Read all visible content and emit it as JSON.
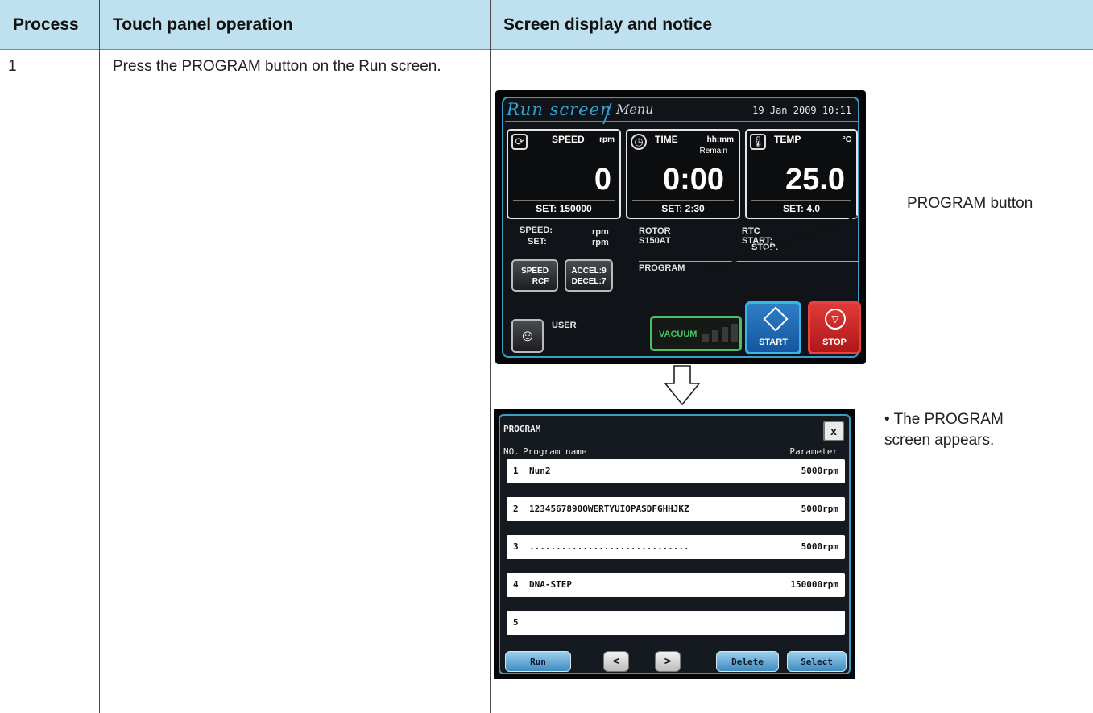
{
  "table": {
    "headers": [
      "Process",
      "Touch panel operation",
      "Screen display and notice"
    ],
    "row1": {
      "process": "1",
      "operation": "Press the PROGRAM button on the Run screen."
    }
  },
  "run_screen": {
    "tab_run": "Run screen",
    "tab_menu": "Menu",
    "datetime": "19 Jan 2009 10:11",
    "speed": {
      "label": "SPEED",
      "unit": "rpm",
      "value": "0",
      "set_label": "SET:",
      "set_value": "150000"
    },
    "time": {
      "label": "TIME",
      "unit": "hh:mm",
      "sub": "Remain",
      "value": "0:00",
      "set_label": "SET:",
      "set_value": "2:30"
    },
    "temp": {
      "label": "TEMP",
      "unit": "°C",
      "value": "25.0",
      "set_label": "SET:",
      "set_value": "4.0"
    },
    "speed_line": "SPEED:",
    "set_line": "SET:",
    "rpm1": "rpm",
    "rpm2": "rpm",
    "speed_rcf_top": "SPEED",
    "speed_rcf_bottom": "RCF",
    "accel": "ACCEL:9",
    "decel": "DECEL:7",
    "rotor_label": "ROTOR",
    "rotor_value": "S150AT",
    "rtc_label": "RTC",
    "rtc_start": "START:",
    "rtc_stop": "STOP:",
    "program_label": "PROGRAM",
    "user_label": "USER",
    "vacuum_label": "VACUUM",
    "start_label": "START",
    "stop_label": "STOP"
  },
  "callout_program_button": "PROGRAM button",
  "program_screen": {
    "title": "PROGRAM",
    "col_no": "NO.",
    "col_name": "Program name",
    "col_param": "Parameter",
    "rows": [
      {
        "no": "1",
        "name": "Nun2",
        "param": "5000rpm"
      },
      {
        "no": "2",
        "name": "1234567890QWERTYUIOPASDFGHHJKZ",
        "param": "5000rpm"
      },
      {
        "no": "3",
        "name": "..............................",
        "param": "5000rpm"
      },
      {
        "no": "4",
        "name": "DNA-STEP",
        "param": "150000rpm"
      },
      {
        "no": "5",
        "name": "",
        "param": ""
      }
    ],
    "btn_run": "Run",
    "btn_prev": "<",
    "btn_next": ">",
    "btn_delete": "Delete",
    "btn_select": "Select",
    "btn_close": "x"
  },
  "notice": "• The PROGRAM screen appears."
}
